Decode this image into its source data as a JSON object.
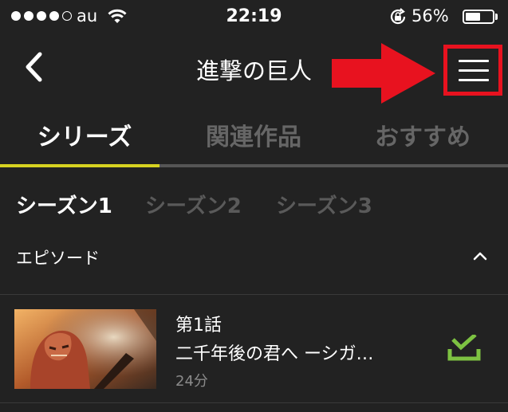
{
  "status_bar": {
    "carrier": "au",
    "time": "22:19",
    "battery": "56%",
    "battery_level": 0.56
  },
  "nav": {
    "title": "進撃の巨人",
    "back_icon": "chevron-left-icon",
    "menu_icon": "hamburger-menu-icon"
  },
  "annotation": {
    "color": "#e8121f"
  },
  "tabs": [
    {
      "label": "シリーズ",
      "active": true
    },
    {
      "label": "関連作品",
      "active": false
    },
    {
      "label": "おすすめ",
      "active": false
    }
  ],
  "seasons": [
    {
      "label": "シーズン1",
      "active": true
    },
    {
      "label": "シーズン2",
      "active": false
    },
    {
      "label": "シーズン3",
      "active": false
    }
  ],
  "section": {
    "label": "エピソード",
    "icon": "chevron-up-icon"
  },
  "episodes": [
    {
      "number": "第1話",
      "title": "二千年後の君へ ーシガ…",
      "duration": "24分",
      "status_icon": "download-done-icon"
    }
  ],
  "colors": {
    "accent": "#d6d221",
    "check_green": "#7dc242",
    "background": "#222222"
  }
}
